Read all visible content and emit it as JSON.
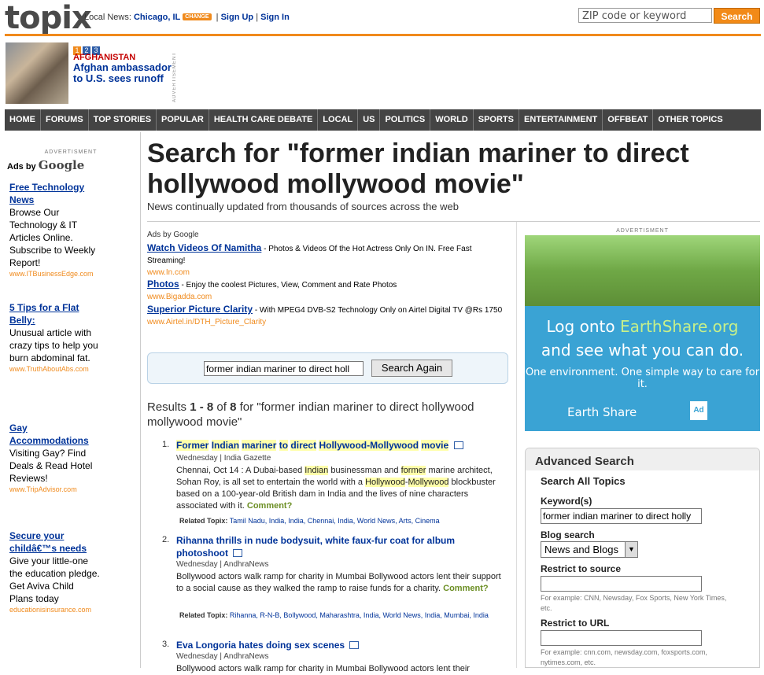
{
  "header": {
    "logo": "topix",
    "local_label": "Local News:",
    "city": "Chicago, IL",
    "change_label": "CHANGE",
    "sep": "|",
    "sign_up": "Sign Up",
    "sign_in": "Sign In",
    "search_placeholder": "ZIP code or keyword",
    "search_button": "Search"
  },
  "headline": {
    "pages": [
      "1",
      "2",
      "3"
    ],
    "kicker": "AFGHANISTAN",
    "title": "Afghan ambassador to U.S. sees runoff",
    "advertisement_label": "ADVERTISEMENT"
  },
  "nav": [
    "HOME",
    "FORUMS",
    "TOP STORIES",
    "POPULAR",
    "HEALTH CARE DEBATE",
    "LOCAL",
    "US",
    "POLITICS",
    "WORLD",
    "SPORTS",
    "ENTERTAINMENT",
    "OFFBEAT",
    "OTHER TOPICS"
  ],
  "left_ads": {
    "advertisement_label": "ADVERTISMENT",
    "ads_by": "Ads by",
    "google": "Google",
    "items": [
      {
        "title": "Free Technology News",
        "desc": "Browse Our Technology & IT Articles Online. Subscribe to Weekly Report!",
        "url": "www.ITBusinessEdge.com"
      },
      {
        "title": "5 Tips for a Flat Belly:",
        "desc": "Unusual article with crazy tips to help you burn abdominal fat.",
        "url": "www.TruthAboutAbs.com"
      },
      {
        "title": "Gay Accommodations",
        "desc": "Visiting Gay? Find Deals & Read Hotel Reviews!",
        "url": "www.TripAdvisor.com"
      },
      {
        "title": "Secure your childâ€™s needs",
        "desc": "Give your little-one the education pledge. Get Aviva Child Plans today",
        "url": "educationisinsurance.com"
      }
    ]
  },
  "main": {
    "title": "Search for \"former indian mariner to direct hollywood mollywood movie\"",
    "subtitle": "News continually updated from thousands of sources across the web",
    "ads_by_google": "Ads by Google",
    "text_ads": [
      {
        "title": "Watch Videos Of Namitha",
        "desc": " - Photos & Videos Of the Hot Actress Only On IN. Free Fast Streaming!",
        "url": "www.In.com"
      },
      {
        "title": "Photos",
        "desc": " - Enjoy the coolest Pictures, View, Comment and Rate Photos",
        "url": "www.Bigadda.com"
      },
      {
        "title": "Superior Picture Clarity",
        "desc": " - With MPEG4 DVB-S2 Technology Only on Airtel Digital TV @Rs 1750",
        "url": "www.Airtel.in/DTH_Picture_Clarity"
      }
    ],
    "search_again_value": "former indian mariner to direct holl",
    "search_again_button": "Search Again",
    "results_prefix": "Results ",
    "results_range": "1 - 8",
    "results_of": " of ",
    "results_total": "8",
    "results_suffix": " for \"former indian mariner to direct hollywood mollywood movie\"",
    "results": [
      {
        "num": "1.",
        "title_parts": [
          "Former",
          "Indian",
          "mariner",
          "to",
          "direct",
          "Hollywood",
          "-",
          "Mollywood",
          "movie"
        ],
        "meta": "Wednesday | India Gazette",
        "body_parts": [
          "Chennai, Oct 14 : A Dubai-based ",
          "Indian",
          " businessman and ",
          "former",
          " marine architect, Sohan Roy, is all set to entertain the world with a ",
          "Hollywood",
          "-",
          "Mollywood",
          " blockbuster based on a 100-year-old British dam in India and the lives of nine characters associated with it. "
        ],
        "comment": "Comment?",
        "related_label": "Related Topix:",
        "related": "Tamil Nadu, India, India, Chennai, India, World News, Arts, Cinema"
      },
      {
        "num": "2.",
        "title": "Rihanna thrills in nude bodysuit, white faux-fur coat for album photoshoot",
        "meta": "Wednesday | AndhraNews",
        "body": "Bollywood actors walk ramp for charity in Mumbai Bollywood actors lent their support to a social cause as they walked the ramp to raise funds for a charity. ",
        "comment": "Comment?",
        "related_label": "Related Topix:",
        "related": "Rihanna, R-N-B, Bollywood, Maharashtra, India, World News, India, Mumbai, India"
      },
      {
        "num": "3.",
        "title": "Eva Longoria hates doing sex scenes",
        "meta": "Wednesday | AndhraNews",
        "body": "Bollywood actors walk ramp for charity in Mumbai Bollywood actors lent their"
      }
    ]
  },
  "right": {
    "advertisement_label": "ADVERTISMENT",
    "ad_line1_prefix": "Log onto ",
    "ad_line1_brand": "EarthShare.org",
    "ad_line2": "and see what you can do.",
    "ad_line3": "One environment. One simple way to care for it.",
    "ad_logo": "Earth Share",
    "ad_council": "Ad",
    "advanced": {
      "title": "Advanced Search",
      "subtitle": "Search All Topics",
      "keyword_label": "Keyword(s)",
      "keyword_value": "former indian mariner to direct holly",
      "blog_label": "Blog search",
      "blog_value": "News and Blogs",
      "source_label": "Restrict to source",
      "source_hint": "For example: CNN, Newsday, Fox Sports, New York Times, etc.",
      "url_label": "Restrict to URL",
      "url_hint": "For example: cnn.com, newsday.com, foxsports.com, nytimes.com, etc."
    }
  }
}
